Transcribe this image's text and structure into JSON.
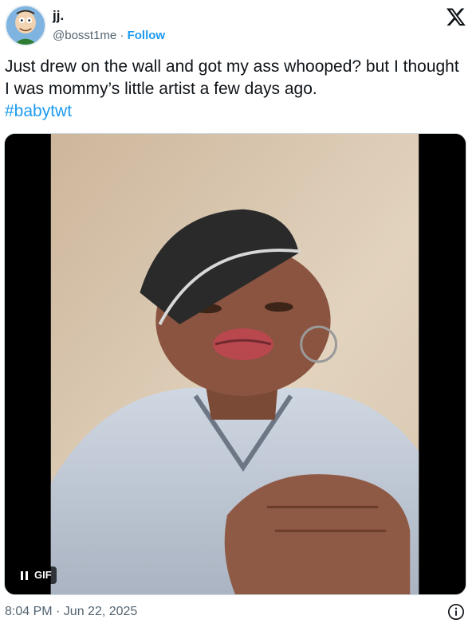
{
  "author": {
    "display_name": "jj.",
    "handle": "@bosst1me",
    "separator": "·",
    "follow_label": "Follow",
    "avatar_icon": "cartoon-avatar-icon"
  },
  "header": {
    "logo_icon": "x-logo-icon"
  },
  "tweet": {
    "text": "Just drew on the wall and got my ass whooped? but I thought I was mommy’s little artist a few days ago.",
    "hashtag": "#babytwt"
  },
  "media": {
    "type": "gif",
    "gif_label": "GIF",
    "pause_icon": "pause-icon"
  },
  "footer": {
    "timestamp": "8:04 PM · Jun 22, 2025",
    "info_icon": "info-icon"
  },
  "colors": {
    "accent": "#1d9bf0",
    "text_primary": "#0f1419",
    "text_secondary": "#536471"
  }
}
